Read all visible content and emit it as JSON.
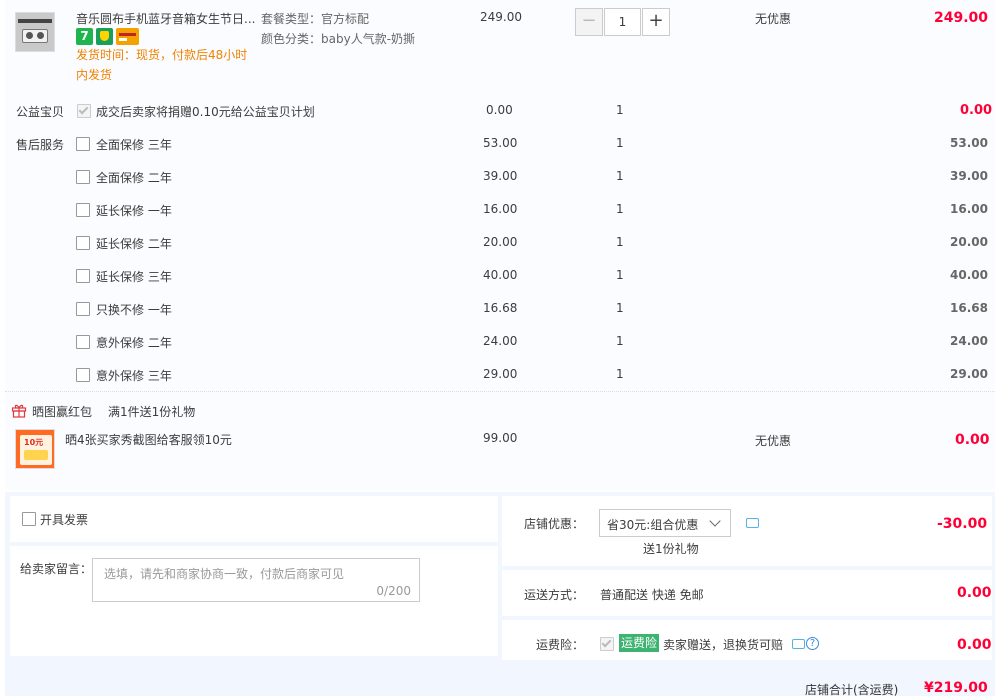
{
  "product": {
    "title": "音乐圆布手机蓝牙音箱女生节日...",
    "spec_package": "套餐类型：官方标配",
    "spec_color": "颜色分类：baby人气款-奶撕",
    "delivery_line1": "发货时间：现货，付款后48小时",
    "delivery_line2": "内发货",
    "price": "249.00",
    "quantity": "1",
    "discount": "无优惠",
    "subtotal": "249.00",
    "icons": [
      "seven-day-return-icon",
      "consumer-guarantee-icon",
      "credit-card-icon"
    ]
  },
  "charity": {
    "label": "公益宝贝",
    "text": "成交后卖家将捐赠0.10元给公益宝贝计划",
    "price": "0.00",
    "qty": "1",
    "subtotal": "0.00"
  },
  "after_sales": {
    "label": "售后服务",
    "items": [
      {
        "name": "全面保修 三年",
        "price": "53.00",
        "qty": "1",
        "subtotal": "53.00"
      },
      {
        "name": "全面保修 二年",
        "price": "39.00",
        "qty": "1",
        "subtotal": "39.00"
      },
      {
        "name": "延长保修 一年",
        "price": "16.00",
        "qty": "1",
        "subtotal": "16.00"
      },
      {
        "name": "延长保修 二年",
        "price": "20.00",
        "qty": "1",
        "subtotal": "20.00"
      },
      {
        "name": "延长保修 三年",
        "price": "40.00",
        "qty": "1",
        "subtotal": "40.00"
      },
      {
        "name": "只换不修 一年",
        "price": "16.68",
        "qty": "1",
        "subtotal": "16.68"
      },
      {
        "name": "意外保修 二年",
        "price": "24.00",
        "qty": "1",
        "subtotal": "24.00"
      },
      {
        "name": "意外保修 三年",
        "price": "29.00",
        "qty": "1",
        "subtotal": "29.00"
      }
    ]
  },
  "gift": {
    "promo_label": "晒图赢红包",
    "promo_rule": "满1件送1份礼物",
    "name": "晒4张买家秀截图给客服领10元",
    "thumb_text": "10元",
    "price": "99.00",
    "discount": "无优惠",
    "subtotal": "0.00"
  },
  "invoice": {
    "label": "开具发票"
  },
  "message": {
    "label": "给卖家留言：",
    "placeholder": "选填，请先和商家协商一致，付款后商家可见",
    "counter": "0/200"
  },
  "shop_discount": {
    "label": "店铺优惠：",
    "selected": "省30元:组合优惠",
    "note": "送1份礼物",
    "amount": "-30.00"
  },
  "shipping": {
    "label": "运送方式：",
    "method": "普通配送 快递 免邮",
    "amount": "0.00"
  },
  "insurance": {
    "label": "运费险：",
    "badge": "运费险",
    "text": "卖家赠送，退换货可赔",
    "amount": "0.00"
  },
  "total": {
    "label": "店铺合计(含运费)",
    "amount": "¥219.00"
  },
  "colors": {
    "price_red": "#ff0036",
    "delivery_orange": "#f08200",
    "panel_blue": "#f2f7ff",
    "badge_green": "#3cb371"
  }
}
